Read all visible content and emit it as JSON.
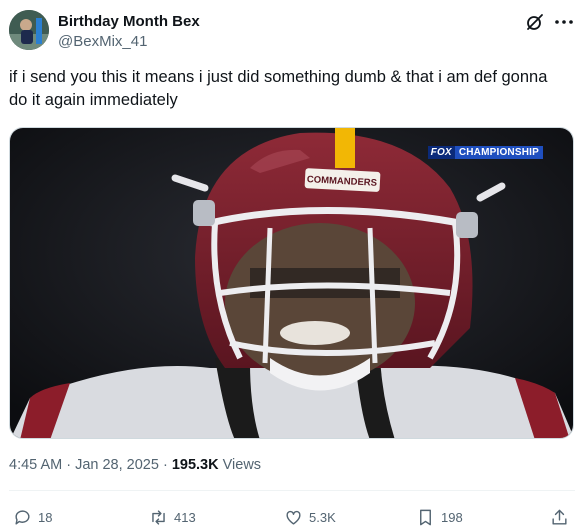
{
  "author": {
    "display_name": "Birthday Month Bex",
    "handle": "@BexMix_41"
  },
  "tweet": {
    "text": "if i send you this it means i just did something dumb & that i am def gonna do it again immediately"
  },
  "media": {
    "helmet_text": "COMMANDERS",
    "broadcast_network": "FOX",
    "broadcast_label": "CHAMPIONSHIP"
  },
  "meta": {
    "timestamp": "4:45 AM · Jan 28, 2025",
    "separator": " · ",
    "views_count": "195.3K",
    "views_label": "Views"
  },
  "actions": {
    "replies": "18",
    "retweets": "413",
    "likes": "5.3K",
    "bookmarks": "198"
  },
  "icons": [
    "grok-icon",
    "more-icon",
    "reply-icon",
    "retweet-icon",
    "like-icon",
    "bookmark-icon",
    "share-icon"
  ],
  "colors": {
    "text_primary": "#0f1419",
    "text_secondary": "#536471",
    "helmet_burgundy": "#7a1f2b",
    "helmet_gold": "#f2b705"
  }
}
